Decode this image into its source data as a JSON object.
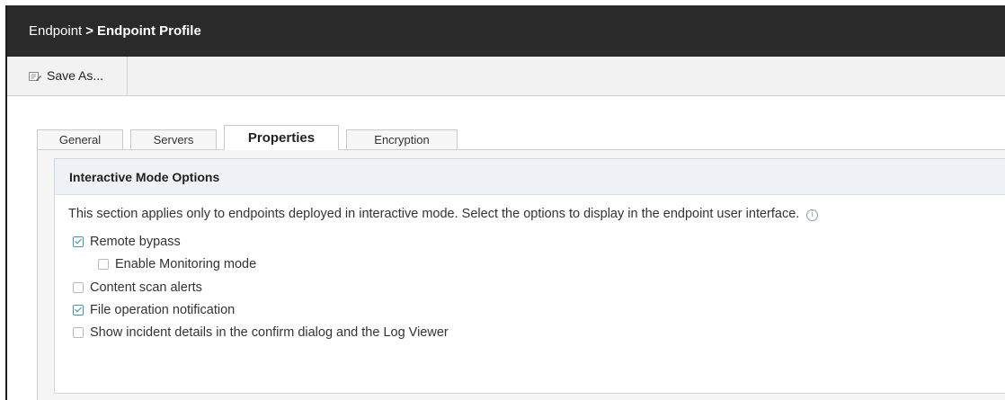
{
  "header": {
    "breadcrumb_root": "Endpoint",
    "breadcrumb_separator": ">",
    "breadcrumb_current": "Endpoint Profile"
  },
  "toolbar": {
    "save_as_label": "Save As...",
    "save_as_icon": "save-as-icon"
  },
  "tabs": [
    {
      "label": "General",
      "active": false
    },
    {
      "label": "Servers",
      "active": false
    },
    {
      "label": "Properties",
      "active": true
    },
    {
      "label": "Encryption",
      "active": false
    }
  ],
  "section": {
    "title": "Interactive Mode Options",
    "description": "This section applies only to endpoints deployed in interactive mode. Select the options to display in the endpoint user interface.",
    "info_icon": "info-icon"
  },
  "options": [
    {
      "label": "Remote bypass",
      "checked": true
    },
    {
      "label": "Enable Monitoring mode",
      "checked": false,
      "highlighted": true
    },
    {
      "label": "Content scan alerts",
      "checked": false
    },
    {
      "label": "File operation notification",
      "checked": true
    },
    {
      "label": "Show incident details in the confirm dialog and the Log Viewer",
      "checked": false
    }
  ],
  "colors": {
    "titlebar_bg": "#2a2a2a",
    "checkbox_accent": "#2a8fa8",
    "highlight_border": "#d83c3c",
    "section_header_bg": "#eef1f5"
  }
}
